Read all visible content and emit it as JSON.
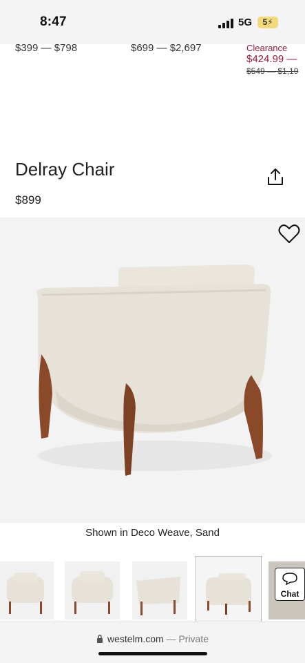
{
  "status_bar": {
    "time": "8:47",
    "network": "5G",
    "battery": "5⚡"
  },
  "top_strip": {
    "price_1": "$399 — $798",
    "price_2": "$699 — $2,697",
    "clearance_label": "Clearance",
    "sale_price": "$424.99 —",
    "original_price": "$549 — $1,19"
  },
  "product": {
    "title": "Delray Chair",
    "price": "$899",
    "caption": "Shown in Deco Weave, Sand"
  },
  "icons": {
    "share": "share-icon",
    "favorite": "heart-icon",
    "chat": "chat-bubble-icon",
    "lock": "lock-icon"
  },
  "thumbnails": [
    {
      "view": "front-three-quarter"
    },
    {
      "view": "front"
    },
    {
      "view": "side"
    },
    {
      "view": "back",
      "selected": true
    },
    {
      "view": "detail"
    }
  ],
  "chat": {
    "label": "Chat"
  },
  "url_bar": {
    "domain": "westelm.com",
    "separator": " — ",
    "mode": "Private"
  },
  "colors": {
    "sale": "#9b1b38",
    "fabric": "#e7e2d8",
    "wood": "#8a4a2a"
  }
}
